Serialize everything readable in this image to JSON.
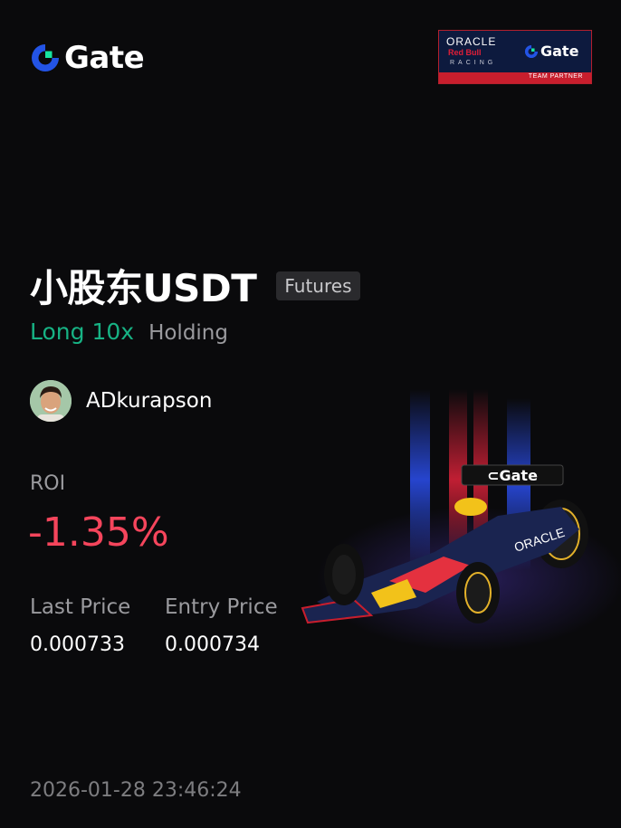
{
  "brand": {
    "name": "Gate",
    "logo_icon": "gate-logo-icon"
  },
  "partner_badge": {
    "oracle": "ORACLE",
    "red_bull": "Red Bull",
    "racing": "RACING",
    "brand": "Gate",
    "footer": "TEAM PARTNER"
  },
  "position": {
    "pair": "小股东USDT",
    "market_type": "Futures",
    "direction": "Long 10x",
    "status": "Holding"
  },
  "user": {
    "avatar_icon": "user-avatar",
    "name": "ADkurapson"
  },
  "roi": {
    "label": "ROI",
    "value": "-1.35%"
  },
  "prices": {
    "last_label": "Last Price",
    "last_value": "0.000733",
    "entry_label": "Entry Price",
    "entry_value": "0.000734"
  },
  "timestamp": "2026-01-28 23:46:24",
  "colors": {
    "background": "#0a0a0c",
    "long_green": "#17b284",
    "roi_red": "#f5455c",
    "gate_blue": "#2354e6",
    "gate_green": "#17e5a1",
    "muted": "#9a9a9e"
  }
}
